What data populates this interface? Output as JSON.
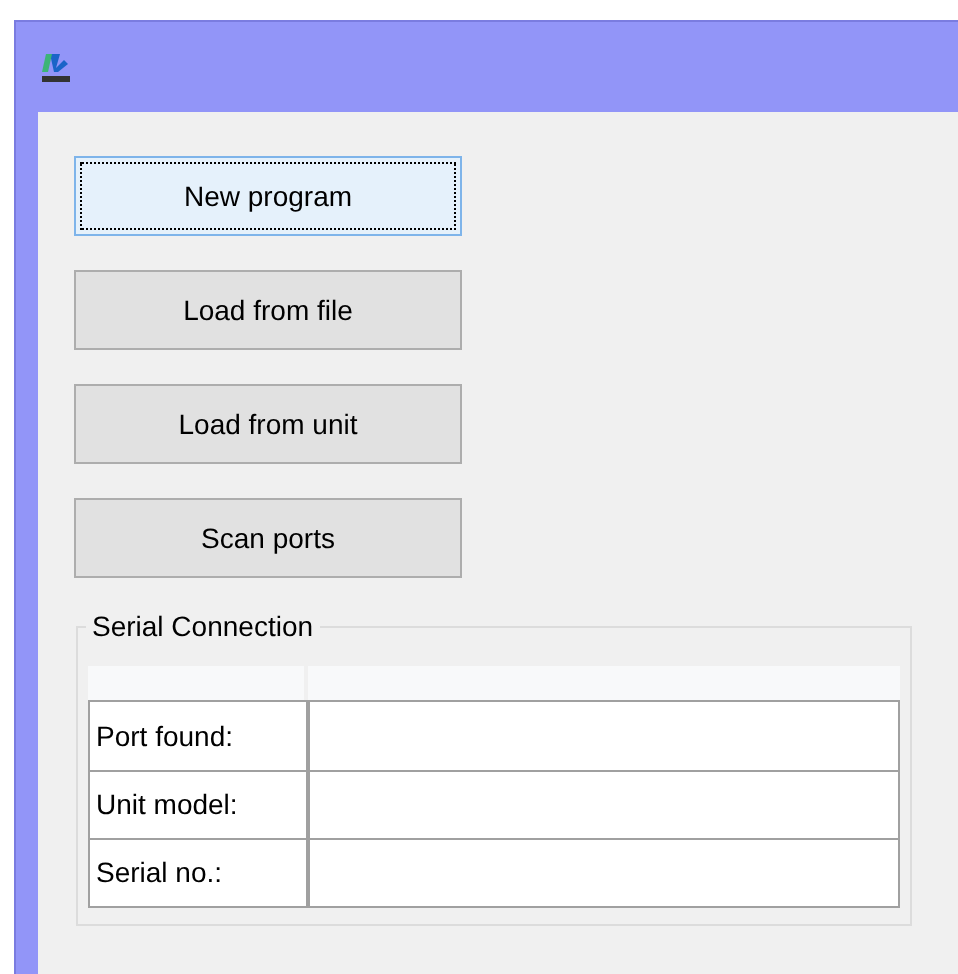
{
  "buttons": [
    {
      "label": "New program",
      "focused": true
    },
    {
      "label": "Load from file",
      "focused": false
    },
    {
      "label": "Load from unit",
      "focused": false
    },
    {
      "label": "Scan ports",
      "focused": false
    }
  ],
  "serial_connection": {
    "title": "Serial Connection",
    "rows": [
      {
        "label": "Port found:"
      },
      {
        "label": "Unit model:"
      },
      {
        "label": "Serial no.:"
      }
    ]
  }
}
